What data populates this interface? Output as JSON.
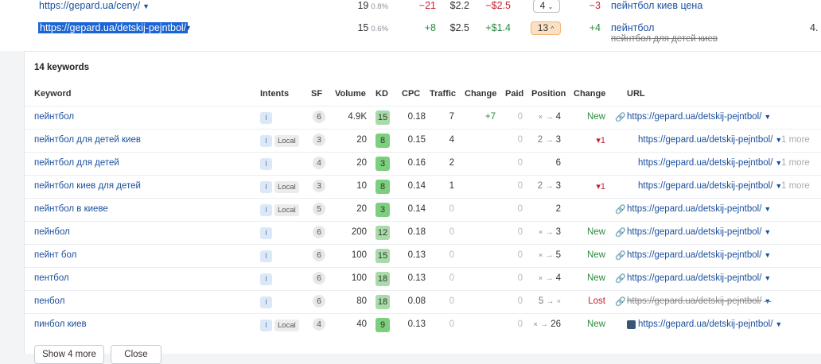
{
  "top_rows": [
    {
      "url": "https://gepard.ua/ceny/",
      "volume": "19",
      "volume_pct": "0.8%",
      "kd_change": "−21",
      "cpc": "$2.2",
      "cost_change": "−$2.5",
      "position": "4",
      "pos_change": "−3",
      "keyword": "пейнтбол киев цена"
    },
    {
      "url": "https://gepard.ua/detskij-pejntbol/",
      "volume": "15",
      "volume_pct": "0.6%",
      "kd_change": "+8",
      "cpc": "$2.5",
      "cost_change": "+$1.4",
      "position": "13",
      "pos_change": "+4",
      "keyword": "пейнтбол",
      "keyword_sub": "пейнтбол для детей киев",
      "edge": "4."
    }
  ],
  "panel": {
    "title": "14 keywords",
    "headers": {
      "keyword": "Keyword",
      "intents": "Intents",
      "sf": "SF",
      "volume": "Volume",
      "kd": "KD",
      "cpc": "CPC",
      "traffic": "Traffic",
      "change": "Change",
      "paid": "Paid",
      "position": "Position",
      "change2": "Change",
      "url": "URL"
    },
    "rows": [
      {
        "kw": "пейнтбол",
        "local": "",
        "sf": "6",
        "volume": "4.9K",
        "kd": "15",
        "cpc": "0.18",
        "traffic": "7",
        "chg": "+7",
        "paid": "0",
        "pos_from": "×",
        "pos_to": "4",
        "chg2": "New",
        "url": "https://gepard.ua/detskij-pejntbol/",
        "more": ""
      },
      {
        "kw": "пейнтбол для детей киев",
        "local": "Local",
        "sf": "3",
        "volume": "20",
        "kd": "8",
        "cpc": "0.15",
        "traffic": "4",
        "chg": "",
        "paid": "0",
        "pos_from": "2",
        "pos_to": "3",
        "chg2": "▾1",
        "url": "https://gepard.ua/detskij-pejntbol/",
        "more": "1 more"
      },
      {
        "kw": "пейнтбол для детей",
        "local": "",
        "sf": "4",
        "volume": "20",
        "kd": "3",
        "cpc": "0.16",
        "traffic": "2",
        "chg": "",
        "paid": "0",
        "pos_from": "",
        "pos_to": "6",
        "chg2": "",
        "url": "https://gepard.ua/detskij-pejntbol/",
        "more": "1 more"
      },
      {
        "kw": "пейнтбол киев для детей",
        "local": "Local",
        "sf": "3",
        "volume": "10",
        "kd": "8",
        "cpc": "0.14",
        "traffic": "1",
        "chg": "",
        "paid": "0",
        "pos_from": "2",
        "pos_to": "3",
        "chg2": "▾1",
        "url": "https://gepard.ua/detskij-pejntbol/",
        "more": "1 more"
      },
      {
        "kw": "пейнтбол в киеве",
        "local": "Local",
        "sf": "5",
        "volume": "20",
        "kd": "3",
        "cpc": "0.14",
        "traffic": "0",
        "chg": "",
        "paid": "0",
        "pos_from": "",
        "pos_to": "2",
        "chg2": "",
        "url": "https://gepard.ua/detskij-pejntbol/",
        "more": ""
      },
      {
        "kw": "пейнбол",
        "local": "",
        "sf": "6",
        "volume": "200",
        "kd": "12",
        "cpc": "0.18",
        "traffic": "0",
        "chg": "",
        "paid": "0",
        "pos_from": "×",
        "pos_to": "3",
        "chg2": "New",
        "url": "https://gepard.ua/detskij-pejntbol/",
        "more": ""
      },
      {
        "kw": "пейнт бол",
        "local": "",
        "sf": "6",
        "volume": "100",
        "kd": "15",
        "cpc": "0.13",
        "traffic": "0",
        "chg": "",
        "paid": "0",
        "pos_from": "×",
        "pos_to": "5",
        "chg2": "New",
        "url": "https://gepard.ua/detskij-pejntbol/",
        "more": ""
      },
      {
        "kw": "пентбол",
        "local": "",
        "sf": "6",
        "volume": "100",
        "kd": "18",
        "cpc": "0.13",
        "traffic": "0",
        "chg": "",
        "paid": "0",
        "pos_from": "×",
        "pos_to": "4",
        "chg2": "New",
        "url": "https://gepard.ua/detskij-pejntbol/",
        "more": ""
      },
      {
        "kw": "пенбол",
        "local": "",
        "sf": "6",
        "volume": "80",
        "kd": "18",
        "cpc": "0.08",
        "traffic": "0",
        "chg": "",
        "paid": "0",
        "pos_from": "5",
        "pos_to": "×",
        "chg2": "Lost",
        "url": "https://gepard.ua/detskij-pejntbol/",
        "more": ""
      },
      {
        "kw": "пинбол киев",
        "local": "Local",
        "sf": "4",
        "volume": "40",
        "kd": "9",
        "cpc": "0.13",
        "traffic": "0",
        "chg": "",
        "paid": "0",
        "pos_from": "×",
        "pos_to": "26",
        "chg2": "New",
        "url": "https://gepard.ua/detskij-pejntbol/",
        "more": ""
      }
    ],
    "intent_tag": "I",
    "show_more": "Show 4 more",
    "close": "Close"
  }
}
